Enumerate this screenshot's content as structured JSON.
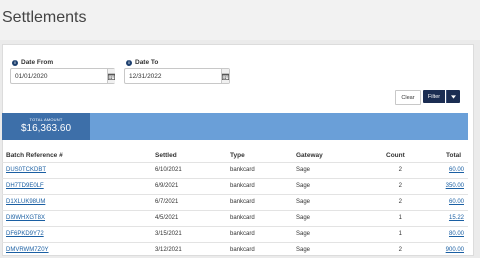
{
  "header": {
    "title": "Settlements"
  },
  "filters": {
    "date_from": {
      "label": "Date From",
      "value": "01/01/2020"
    },
    "date_to": {
      "label": "Date To",
      "value": "12/31/2022"
    },
    "clear_label": "Clear",
    "filter_label": "Filter"
  },
  "summary": {
    "total_label": "TOTAL AMOUNT",
    "total_value": "$16,363.60"
  },
  "table": {
    "columns": [
      "Batch Reference #",
      "Settled",
      "Type",
      "Gateway",
      "Count",
      "Total"
    ],
    "rows": [
      {
        "ref": "DUS0TCKDBT",
        "settled": "6/10/2021",
        "type": "bankcard",
        "gateway": "Sage",
        "count": "2",
        "total": "60.00"
      },
      {
        "ref": "DH7TD9E0LF",
        "settled": "6/9/2021",
        "type": "bankcard",
        "gateway": "Sage",
        "count": "2",
        "total": "350.00"
      },
      {
        "ref": "D1XLUK98UM",
        "settled": "6/7/2021",
        "type": "bankcard",
        "gateway": "Sage",
        "count": "2",
        "total": "60.00"
      },
      {
        "ref": "DI9WHXGT8X",
        "settled": "4/5/2021",
        "type": "bankcard",
        "gateway": "Sage",
        "count": "1",
        "total": "15.22"
      },
      {
        "ref": "DF6PKD9Y72",
        "settled": "3/15/2021",
        "type": "bankcard",
        "gateway": "Sage",
        "count": "1",
        "total": "80.00"
      },
      {
        "ref": "DMVRWM7Z0Y",
        "settled": "3/12/2021",
        "type": "bankcard",
        "gateway": "Sage",
        "count": "2",
        "total": "900.00"
      }
    ]
  },
  "colors": {
    "primary_button": "#1b2d52",
    "summary_bar": "#6a9fd8",
    "summary_total_box": "#3d6fa9",
    "link": "#1a5fa3"
  },
  "icons": {
    "info": "info-icon",
    "calendar": "calendar-icon",
    "caret": "caret-down-icon"
  }
}
